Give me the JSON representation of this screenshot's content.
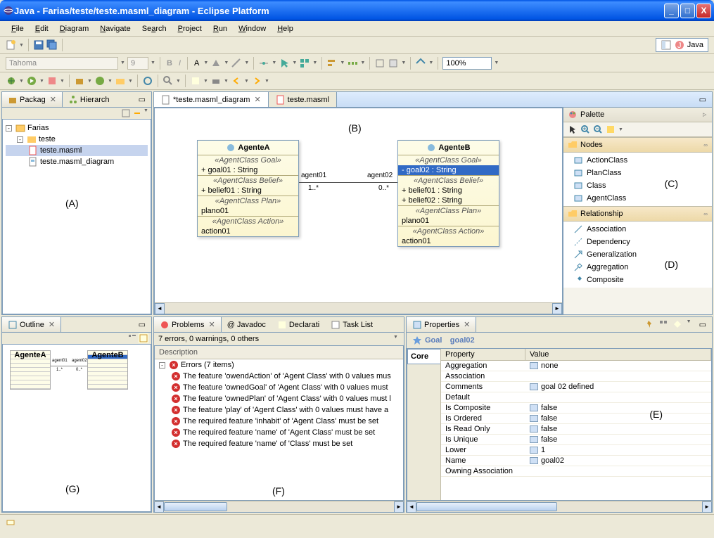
{
  "window": {
    "title": "Java - Farias/teste/teste.masml_diagram - Eclipse Platform"
  },
  "menu": [
    "File",
    "Edit",
    "Diagram",
    "Navigate",
    "Search",
    "Project",
    "Run",
    "Window",
    "Help"
  ],
  "font_name": "Tahoma",
  "font_size": "9",
  "zoom": "100%",
  "perspective": "Java",
  "packageExplorer": {
    "tab1": "Packag",
    "tab2": "Hierarch",
    "root": "Farias",
    "folder": "teste",
    "file1": "teste.masml",
    "file2": "teste.masml_diagram"
  },
  "editor": {
    "tab_active": "*teste.masml_diagram",
    "tab_other": "teste.masml"
  },
  "labels": {
    "A": "(A)",
    "B": "(B)",
    "C": "(C)",
    "D": "(D)",
    "E": "(E)",
    "F": "(F)",
    "G": "(G)"
  },
  "agentA": {
    "name": "AgenteA",
    "stereo_goal": "«AgentClass Goal»",
    "goal": "+ goal01 : String",
    "stereo_belief": "«AgentClass Belief»",
    "belief": "+ belief01 : String",
    "stereo_plan": "«AgentClass Plan»",
    "plan": "plano01",
    "stereo_action": "«AgentClass Action»",
    "action": "action01"
  },
  "agentB": {
    "name": "AgenteB",
    "stereo_goal": "«AgentClass Goal»",
    "goal": "- goal02 : String",
    "stereo_belief": "«AgentClass Belief»",
    "belief1": "+ belief01 : String",
    "belief2": "+ belief02 : String",
    "stereo_plan": "«AgentClass Plan»",
    "plan": "plano01",
    "stereo_action": "«AgentClass Action»",
    "action": "action01"
  },
  "assoc": {
    "role1": "agent01",
    "mult1": "1..*",
    "role2": "agent02",
    "mult2": "0..*"
  },
  "palette": {
    "title": "Palette",
    "drawer_nodes": "Nodes",
    "nodes": [
      "ActionClass",
      "PlanClass",
      "Class",
      "AgentClass"
    ],
    "drawer_rel": "Relationship",
    "rels": [
      "Association",
      "Dependency",
      "Generalization",
      "Aggregation",
      "Composite"
    ]
  },
  "outline": {
    "tab": "Outline"
  },
  "problems": {
    "tab_problems": "Problems",
    "tab_javadoc": "Javadoc",
    "tab_declaration": "Declarati",
    "tab_tasklist": "Task List",
    "summary": "7 errors, 0 warnings, 0 others",
    "header": "Description",
    "group": "Errors (7 items)",
    "items": [
      "The feature 'owendAction' of 'Agent Class' with 0 values mus",
      "The feature 'ownedGoal' of 'Agent Class' with 0 values must",
      "The feature 'ownedPlan' of 'Agent Class' with 0 values must l",
      "The feature 'play' of 'Agent Class' with 0 values must have a",
      "The required feature 'inhabit' of 'Agent Class' must be set",
      "The required feature 'name' of 'Agent Class' must be set",
      "The required feature 'name' of 'Class' must be set"
    ]
  },
  "properties": {
    "tab": "Properties",
    "title_prefix": "Goal",
    "title_name": "goal02",
    "sidetab": "Core",
    "hdr_prop": "Property",
    "hdr_val": "Value",
    "rows": [
      {
        "p": "Aggregation",
        "v": "none",
        "i": true
      },
      {
        "p": "Association",
        "v": "",
        "i": false
      },
      {
        "p": "Comments",
        "v": "goal 02 defined",
        "i": true
      },
      {
        "p": "Default",
        "v": "",
        "i": false
      },
      {
        "p": "Is Composite",
        "v": "false",
        "i": true
      },
      {
        "p": "Is Ordered",
        "v": "false",
        "i": true
      },
      {
        "p": "Is Read Only",
        "v": "false",
        "i": true
      },
      {
        "p": "Is Unique",
        "v": "false",
        "i": true
      },
      {
        "p": "Lower",
        "v": "1",
        "i": true
      },
      {
        "p": "Name",
        "v": "goal02",
        "i": true
      },
      {
        "p": "Owning Association",
        "v": "",
        "i": false
      }
    ]
  }
}
